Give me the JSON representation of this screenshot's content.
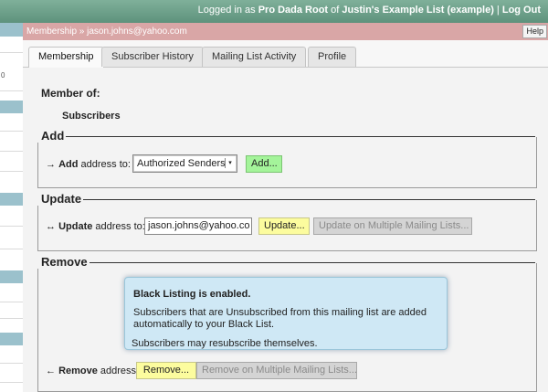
{
  "topbar": {
    "prefix": "Logged in as ",
    "user": "Pro Dada Root",
    "of": " of ",
    "list": "Justin's Example List (example)",
    "sep": " | ",
    "logout": "Log Out"
  },
  "sidebar": {
    "fragment": "0"
  },
  "crumb": "Membership » jason.johns@yahoo.com",
  "help": "Help",
  "tabs": [
    {
      "label": "Membership",
      "active": true
    },
    {
      "label": "Subscriber History"
    },
    {
      "label": "Mailing List Activity"
    },
    {
      "label": "Profile"
    }
  ],
  "member_of": {
    "heading": "Member of:",
    "list": "Subscribers"
  },
  "add": {
    "title": "Add",
    "arrow": "→",
    "bold": "Add",
    "text": " address to:",
    "select_value": "Authorized Senders",
    "button": "Add..."
  },
  "update": {
    "title": "Update",
    "arrow": "↔",
    "bold": "Update",
    "text": " address to:",
    "input_value": "jason.johns@yahoo.co",
    "button": "Update...",
    "multi_button": "Update on Multiple Mailing Lists..."
  },
  "remove": {
    "title": "Remove",
    "arrow": "←",
    "bold": "Remove",
    "text": " address:",
    "button": "Remove...",
    "multi_button": "Remove on Multiple Mailing Lists..."
  },
  "notice": {
    "title": "Black Listing is enabled.",
    "line1": "Subscribers that are Unsubscribed from this mailing list are added automatically to your Black List.",
    "line2": "Subscribers may resubscribe themselves."
  },
  "colors": {
    "topbar": "#6fa18b",
    "crumbbar": "#d9a6a6",
    "add_button": "#a4f49a",
    "yellow_button": "#fcfc9e",
    "notice_bg": "#cfe8f5"
  }
}
